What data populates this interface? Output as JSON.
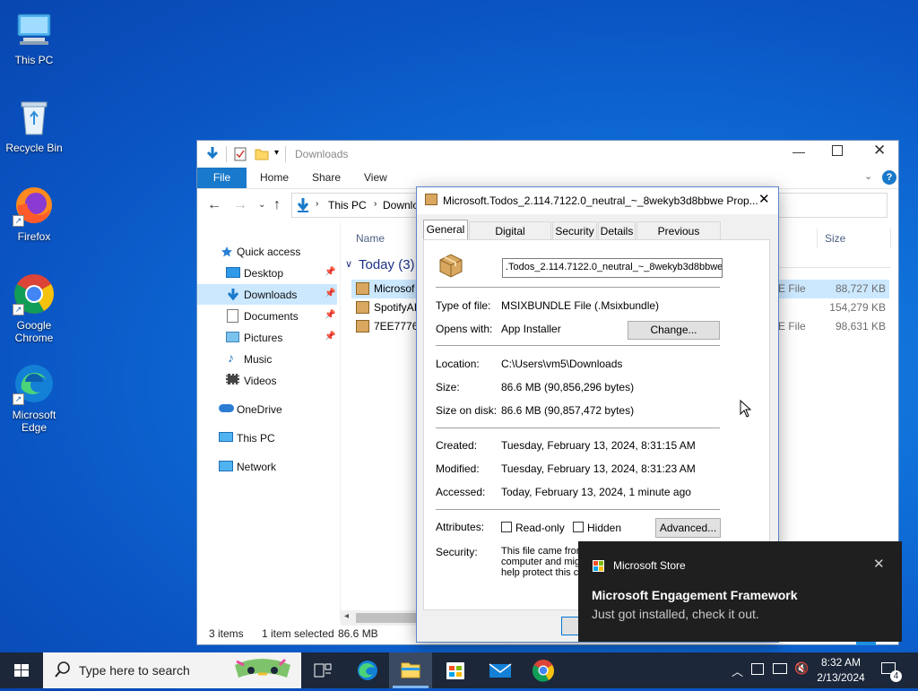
{
  "desktop": {
    "icons": [
      {
        "label": "This PC"
      },
      {
        "label": "Recycle Bin"
      },
      {
        "label": "Firefox"
      },
      {
        "label": "Google Chrome"
      },
      {
        "label": "Microsoft Edge"
      }
    ]
  },
  "explorer": {
    "title": "Downloads",
    "ribbon_tabs": [
      "File",
      "Home",
      "Share",
      "View"
    ],
    "address": {
      "segments": [
        "This PC",
        "Downlo"
      ]
    },
    "columns": {
      "name": "Name",
      "size": "Size"
    },
    "group": "Today (3)",
    "files": [
      {
        "name": "Microsof",
        "type": "E File",
        "size": "88,727 KB"
      },
      {
        "name": "SpotifyAI",
        "type": "",
        "size": "154,279 KB"
      },
      {
        "name": "7EE7776C",
        "type": "E File",
        "size": "98,631 KB"
      }
    ],
    "nav": {
      "quick_access": "Quick access",
      "items": [
        "Desktop",
        "Downloads",
        "Documents",
        "Pictures",
        "Music",
        "Videos"
      ],
      "onedrive": "OneDrive",
      "this_pc": "This PC",
      "network": "Network"
    },
    "status": {
      "items": "3 items",
      "selected": "1 item selected",
      "size": "86.6 MB"
    }
  },
  "props": {
    "title": "Microsoft.Todos_2.114.7122.0_neutral_~_8wekyb3d8bbwe Prop...",
    "tabs": [
      "General",
      "Digital Signatures",
      "Security",
      "Details",
      "Previous Versions"
    ],
    "filename": ".Todos_2.114.7122.0_neutral_~_8wekyb3d8bbwe",
    "type_label": "Type of file:",
    "type_value": "MSIXBUNDLE File (.Msixbundle)",
    "opens_label": "Opens with:",
    "opens_value": "App Installer",
    "change_button": "Change...",
    "location_label": "Location:",
    "location_value": "C:\\Users\\vm5\\Downloads",
    "size_label": "Size:",
    "size_value": "86.6 MB (90,856,296 bytes)",
    "size_disk_label": "Size on disk:",
    "size_disk_value": "86.6 MB (90,857,472 bytes)",
    "created_label": "Created:",
    "created_value": "Tuesday, February 13, 2024, 8:31:15 AM",
    "modified_label": "Modified:",
    "modified_value": "Tuesday, February 13, 2024, 8:31:23 AM",
    "accessed_label": "Accessed:",
    "accessed_value": "Today, February 13, 2024, 1 minute ago",
    "attributes_label": "Attributes:",
    "readonly_label": "Read-only",
    "hidden_label": "Hidden",
    "advanced_button": "Advanced...",
    "security_label": "Security:",
    "security_lines": [
      "This file came from",
      "computer and migh",
      "help protect this co"
    ]
  },
  "toast": {
    "app": "Microsoft Store",
    "title": "Microsoft Engagement Framework",
    "body": "Just got installed, check it out."
  },
  "taskbar": {
    "search_placeholder": "Type here to search",
    "time": "8:32 AM",
    "date": "2/13/2024",
    "notification_count": "4"
  },
  "colors": {
    "accent": "#1979ca",
    "selection": "#cce8ff",
    "taskbar": "#1c2739"
  }
}
